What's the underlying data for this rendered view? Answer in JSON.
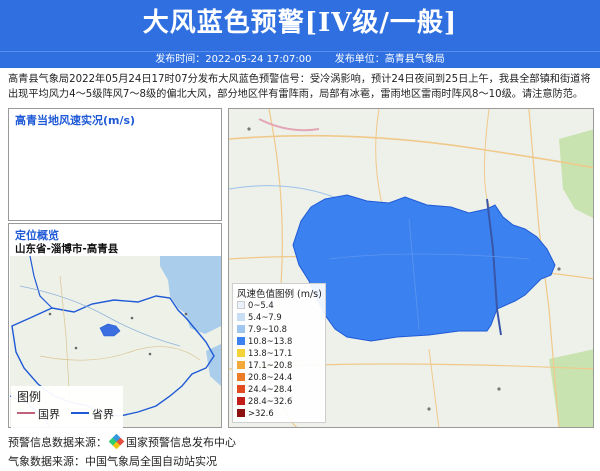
{
  "header": {
    "title": "大风蓝色预警[IV级/一般]",
    "publish_time_label": "发布时间：2022-05-24 17:07:00",
    "publisher_label": "发布单位：高青县气象局"
  },
  "description": "高青县气象局2022年05月24日17时07分发布大风蓝色预警信号：受冷涡影响，预计24日夜间到25日上午，我县全部镇和街道将出现平均风力4～5级阵风7～8级的偏北大风，部分地区伴有雷阵雨，局部有冰雹，雷雨地区雷雨时阵风8～10级。请注意防范。",
  "wind_panel": {
    "title": "高青当地风速实况(m/s)"
  },
  "locate_panel": {
    "title": "定位概览",
    "subtitle": "山东省-淄博市-高青县",
    "legend_title": "图例",
    "legend_items": [
      {
        "label": "国界",
        "color": "#c0637a"
      },
      {
        "label": "省界",
        "color": "#1f5ad6"
      }
    ]
  },
  "wind_legend": {
    "title": "风速色值图例 (m/s)",
    "items": [
      {
        "label": "0~5.4",
        "color": "#eaf2fb"
      },
      {
        "label": "5.4~7.9",
        "color": "#c8def5"
      },
      {
        "label": "7.9~10.8",
        "color": "#9ec6ee"
      },
      {
        "label": "10.8~13.8",
        "color": "#3b82f0"
      },
      {
        "label": "13.8~17.1",
        "color": "#f3d23a"
      },
      {
        "label": "17.1~20.8",
        "color": "#f2a93a"
      },
      {
        "label": "20.8~24.4",
        "color": "#ee7d2a"
      },
      {
        "label": "24.4~28.4",
        "color": "#e24a1f"
      },
      {
        "label": "28.4~32.6",
        "color": "#c11d1a"
      },
      {
        "label": ">32.6",
        "color": "#8c1010"
      }
    ]
  },
  "footer": {
    "warning_source_label": "预警信息数据来源：",
    "warning_source": "国家预警信息发布中心",
    "weather_source_label": "气象数据来源：",
    "weather_source": "中国气象局全国自动站实况"
  }
}
